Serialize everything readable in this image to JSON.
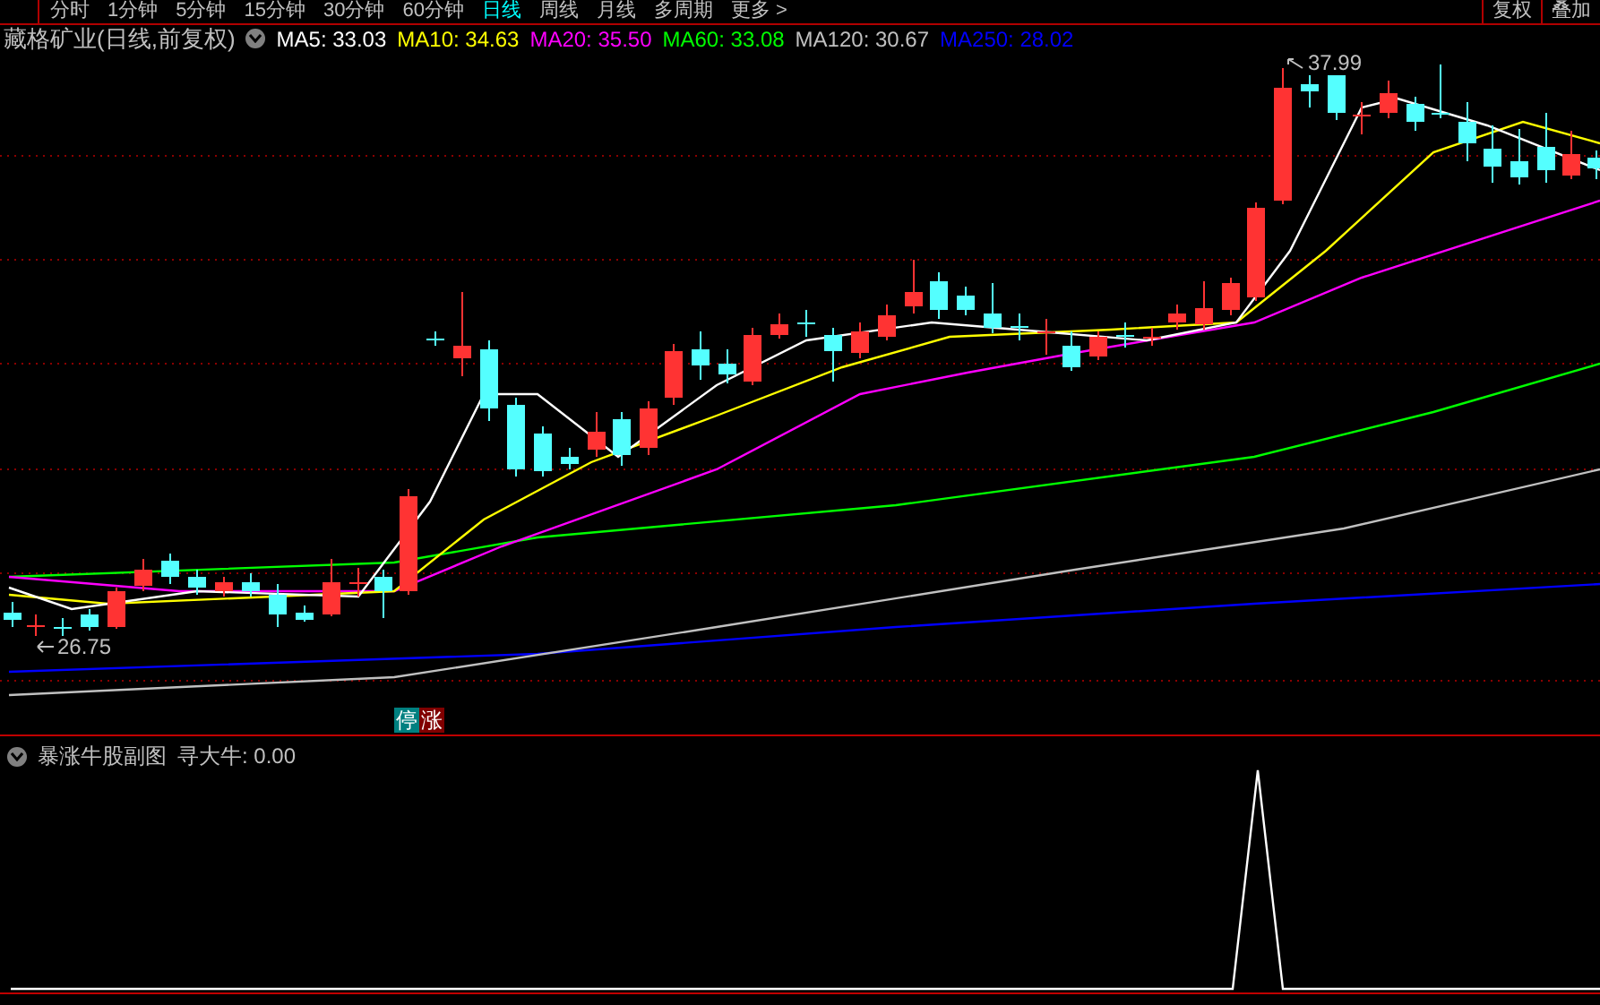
{
  "toolbar": {
    "periods": [
      {
        "label": "分时",
        "selected": false
      },
      {
        "label": "1分钟",
        "selected": false
      },
      {
        "label": "5分钟",
        "selected": false
      },
      {
        "label": "15分钟",
        "selected": false
      },
      {
        "label": "30分钟",
        "selected": false
      },
      {
        "label": "60分钟",
        "selected": false
      },
      {
        "label": "日线",
        "selected": true
      },
      {
        "label": "周线",
        "selected": false
      },
      {
        "label": "月线",
        "selected": false
      },
      {
        "label": "多周期",
        "selected": false
      },
      {
        "label": "更多 >",
        "selected": false
      }
    ],
    "buttons": [
      "复权",
      "叠加"
    ]
  },
  "legend": {
    "title": "藏格矿业(日线,前复权)",
    "averages": [
      {
        "label": "MA5: 33.03",
        "color": "#ffffff"
      },
      {
        "label": "MA10: 34.63",
        "color": "#ffff00"
      },
      {
        "label": "MA20: 35.50",
        "color": "#ff00ff"
      },
      {
        "label": "MA60: 33.08",
        "color": "#00ff00"
      },
      {
        "label": "MA120: 30.67",
        "color": "#c0c0c0"
      },
      {
        "label": "MA250: 28.02",
        "color": "#0000ff"
      }
    ]
  },
  "price_chart": {
    "high_label": "37.99",
    "low_label": "26.75",
    "badges": [
      {
        "label": "停",
        "color": "#008080"
      },
      {
        "label": "涨",
        "color": "#800000"
      }
    ]
  },
  "indicator": {
    "title": "暴涨牛股副图",
    "value": "寻大牛: 0.00"
  }
}
